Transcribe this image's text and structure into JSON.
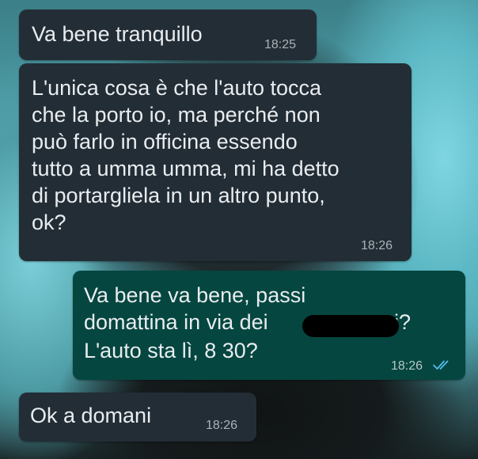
{
  "colors": {
    "incoming_bubble": "#232d36",
    "outgoing_bubble": "#054640",
    "read_ticks": "#53bdeb",
    "redaction": "#000000"
  },
  "messages": [
    {
      "direction": "incoming",
      "text": "Va bene tranquillo",
      "time": "18:25"
    },
    {
      "direction": "incoming",
      "text": "L'unica cosa è che l'auto tocca\nche la porto io, ma perché non\npuò farlo in officina essendo\ntutto a umma umma, mi ha detto\ndi portargliela in un altro punto,\nok?",
      "time": "18:26"
    },
    {
      "direction": "outgoing",
      "text_line1": "Va bene va bene, passi",
      "text_line2_prefix": "domattina in via dei",
      "text_line2_suffix": "i?",
      "text_line3": "L'auto sta lì, 8 30?",
      "time": "18:26",
      "status_icon": "double-check-read-icon"
    },
    {
      "direction": "incoming",
      "text": "Ok a domani",
      "time": "18:26"
    }
  ]
}
